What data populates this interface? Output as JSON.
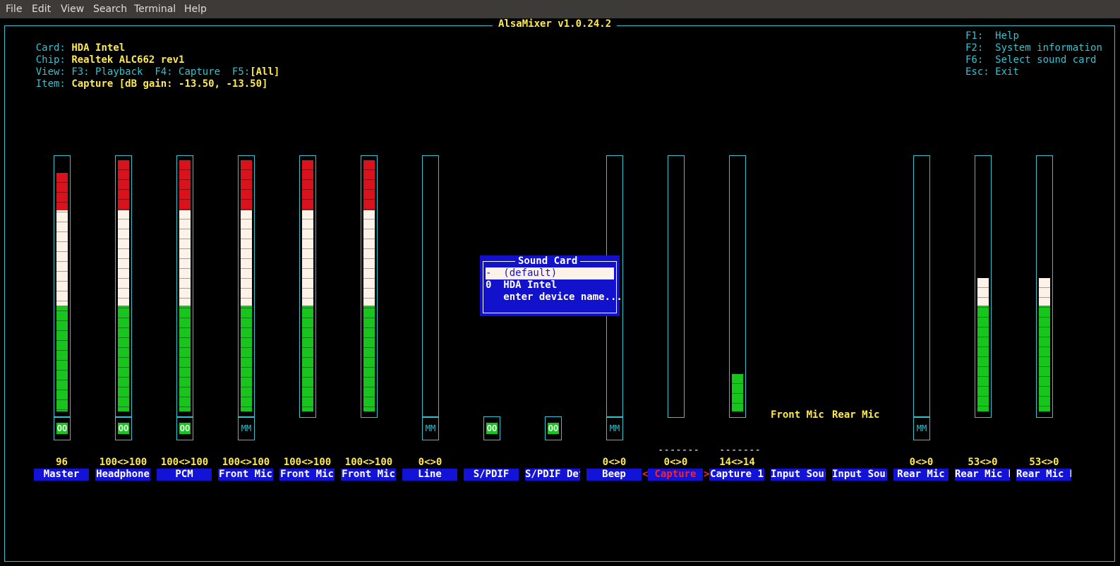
{
  "menu": [
    "File",
    "Edit",
    "View",
    "Search",
    "Terminal",
    "Help"
  ],
  "title": "AlsaMixer v1.0.24.2",
  "info": {
    "card_label": "Card:",
    "card": "HDA Intel",
    "chip_label": "Chip:",
    "chip": "Realtek ALC662 rev1",
    "view_label": "View:",
    "view_f3": "F3: Playback",
    "view_f4": "F4: Capture",
    "view_f5": "F5:",
    "view_all": "[All]",
    "item_label": "Item:",
    "item": "Capture [dB gain: -13.50, -13.50]"
  },
  "help": [
    {
      "key": "F1:",
      "text": "Help"
    },
    {
      "key": "F2:",
      "text": "System information"
    },
    {
      "key": "F6:",
      "text": "Select sound card"
    },
    {
      "key": "Esc:",
      "text": "Exit"
    }
  ],
  "controls": [
    {
      "name": "Master",
      "volume": "96",
      "level": 0.95,
      "switch": "OO"
    },
    {
      "name": "Headphone",
      "volume": "100<>100",
      "level": 1.0,
      "switch": "OO"
    },
    {
      "name": "PCM",
      "volume": "100<>100",
      "level": 1.0,
      "switch": "OO"
    },
    {
      "name": "Front Mic",
      "volume": "100<>100",
      "level": 1.0,
      "switch": "MM"
    },
    {
      "name": "Front Mic",
      "volume": "100<>100",
      "level": 1.0,
      "switch": ""
    },
    {
      "name": "Front Mic",
      "volume": "100<>100",
      "level": 1.0,
      "switch": ""
    },
    {
      "name": "Line",
      "volume": "0<>0",
      "level": 0.0,
      "switch": "MM"
    },
    {
      "name": "S/PDIF",
      "volume": "",
      "level": null,
      "switch": "OO"
    },
    {
      "name": "S/PDIF Def",
      "volume": "",
      "level": null,
      "switch": "OO"
    },
    {
      "name": "Beep",
      "volume": "0<>0",
      "level": 0.0,
      "switch": "MM"
    },
    {
      "name": "Capture",
      "volume": "0<>0",
      "level": 0.0,
      "switch": "",
      "selected": true,
      "dash": "-------"
    },
    {
      "name": "Capture 1",
      "volume": "14<>14",
      "level": 0.15,
      "switch": "",
      "dash": "-------"
    },
    {
      "name": "Input Sour",
      "volume": "",
      "level": null,
      "switch": "",
      "enum": "Front Mic"
    },
    {
      "name": "Input Sour",
      "volume": "",
      "level": null,
      "switch": "",
      "enum": "Rear Mic"
    },
    {
      "name": "Rear Mic",
      "volume": "0<>0",
      "level": 0.0,
      "switch": "MM"
    },
    {
      "name": "Rear Mic B",
      "volume": "53<>0",
      "level": 0.53,
      "switch": ""
    },
    {
      "name": "Rear Mic B",
      "volume": "53<>0",
      "level": 0.53,
      "switch": ""
    }
  ],
  "select_arrows": {
    "left": "<",
    "right": ">"
  },
  "dialog": {
    "title": "Sound Card",
    "options": [
      {
        "text": "-  (default)",
        "highlighted": true
      },
      {
        "text": "0  HDA Intel",
        "highlighted": false
      },
      {
        "text": "   enter device name...",
        "highlighted": false
      }
    ]
  },
  "colors": {
    "cyan": "#35c2d0",
    "yellow": "#ffea4d",
    "green": "#17c51d",
    "red": "#d9121b",
    "blue": "#1313d8"
  }
}
